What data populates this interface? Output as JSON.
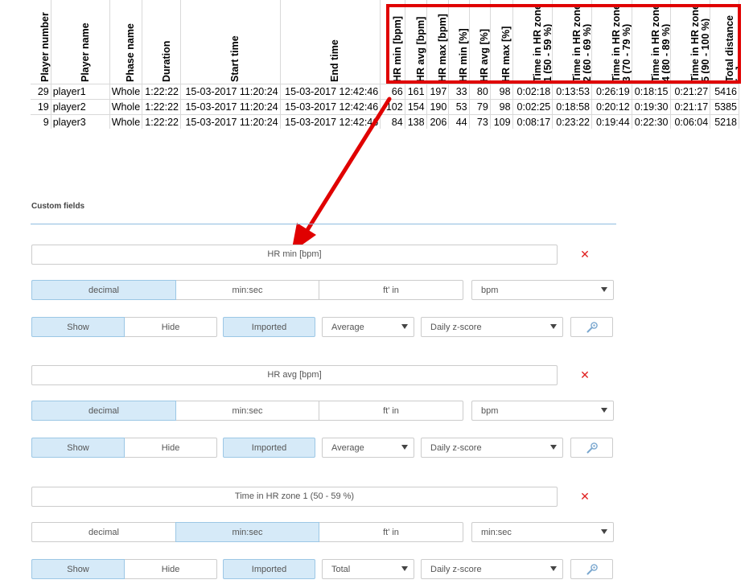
{
  "sheet": {
    "headers": [
      "Player number",
      "Player name",
      "Phase name",
      "Duration",
      "Start time",
      "End time",
      "HR min [bpm]",
      "HR avg [bpm]",
      "HR max [bpm]",
      "HR min [%]",
      "HR avg [%]",
      "HR max [%]",
      "Time in HR zone 1 (50 - 59 %)",
      "Time in HR zone 2 (60 - 69 %)",
      "Time in HR zone 3 (70 - 79 %)",
      "Time in HR zone 4 (80 - 89 %)",
      "Time in HR zone 5 (90 - 100 %)",
      "Total distance [m]"
    ],
    "header_lines": [
      [
        "Player number"
      ],
      [
        "Player name"
      ],
      [
        "Phase name"
      ],
      [
        "Duration"
      ],
      [
        "Start time"
      ],
      [
        "End time"
      ],
      [
        "HR min [bpm]"
      ],
      [
        "HR avg [bpm]"
      ],
      [
        "HR max [bpm]"
      ],
      [
        "HR min [%]"
      ],
      [
        "HR avg [%]"
      ],
      [
        "HR max [%]"
      ],
      [
        "Time in HR zone",
        "1 (50 - 59 %)"
      ],
      [
        "Time in HR zone",
        "2 (60 - 69 %)"
      ],
      [
        "Time in HR zone",
        "3 (70 - 79 %)"
      ],
      [
        "Time in HR zone",
        "4 (80 - 89 %)"
      ],
      [
        "Time in HR zone",
        "5 (90 - 100 %)"
      ],
      [
        "Total distance",
        "[m]"
      ]
    ],
    "rows": [
      [
        "29",
        "player1",
        "Whole",
        "1:22:22",
        "15-03-2017 11:20:24",
        "15-03-2017 12:42:46",
        "66",
        "161",
        "197",
        "33",
        "80",
        "98",
        "0:02:18",
        "0:13:53",
        "0:26:19",
        "0:18:15",
        "0:21:27",
        "5416"
      ],
      [
        "19",
        "player2",
        "Whole",
        "1:22:22",
        "15-03-2017 11:20:24",
        "15-03-2017 12:42:46",
        "102",
        "154",
        "190",
        "53",
        "79",
        "98",
        "0:02:25",
        "0:18:58",
        "0:20:12",
        "0:19:30",
        "0:21:17",
        "5385"
      ],
      [
        "9",
        "player3",
        "Whole",
        "1:22:22",
        "15-03-2017 11:20:24",
        "15-03-2017 12:42:46",
        "84",
        "138",
        "206",
        "44",
        "73",
        "109",
        "0:08:17",
        "0:23:22",
        "0:19:44",
        "0:22:30",
        "0:06:04",
        "5218"
      ]
    ]
  },
  "colors": {
    "highlight": "#e00000",
    "active": "#d6eaf8",
    "remove": "#e02020",
    "rule": "#8fbce0"
  },
  "custom_fields": {
    "title": "Custom fields",
    "fields": [
      {
        "name": "HR min [bpm]",
        "formats": [
          "decimal",
          "min:sec",
          "ft' in"
        ],
        "active_format": 0,
        "unit": "bpm",
        "visibility": [
          "Show",
          "Hide"
        ],
        "active_visibility": 0,
        "source": "Imported",
        "aggregation": "Average",
        "score": "Daily z-score",
        "remove_icon": "close-icon",
        "tool_icon": "wrench-icon"
      },
      {
        "name": "HR avg [bpm]",
        "formats": [
          "decimal",
          "min:sec",
          "ft' in"
        ],
        "active_format": 0,
        "unit": "bpm",
        "visibility": [
          "Show",
          "Hide"
        ],
        "active_visibility": 0,
        "source": "Imported",
        "aggregation": "Average",
        "score": "Daily z-score",
        "remove_icon": "close-icon",
        "tool_icon": "wrench-icon"
      },
      {
        "name": "Time in HR zone 1 (50 - 59 %)",
        "formats": [
          "decimal",
          "min:sec",
          "ft' in"
        ],
        "active_format": 1,
        "unit": "min:sec",
        "visibility": [
          "Show",
          "Hide"
        ],
        "active_visibility": 0,
        "source": "Imported",
        "aggregation": "Total",
        "score": "Daily z-score",
        "remove_icon": "close-icon",
        "tool_icon": "wrench-icon"
      }
    ]
  }
}
